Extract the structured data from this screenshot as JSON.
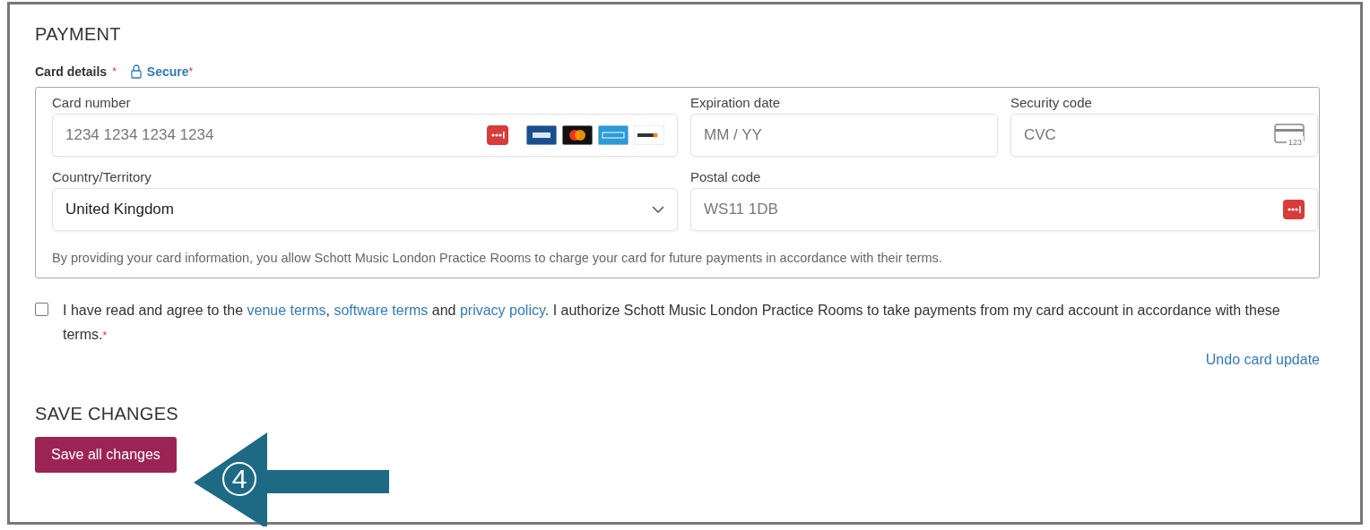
{
  "payment": {
    "title": "PAYMENT",
    "card_details_label": "Card details",
    "card_details_mark": "*",
    "secure_label": "Secure",
    "secure_mark": "*",
    "fields": [
      {
        "kind": "card",
        "label": "Card number",
        "placeholder": "1234 1234 1234 1234"
      },
      {
        "kind": "plain",
        "label": "Expiration date",
        "placeholder": "MM / YY"
      },
      {
        "kind": "cvc",
        "label": "Security code",
        "placeholder": "CVC",
        "icon_text": "123"
      },
      {
        "kind": "select",
        "label": "Country/Territory",
        "value": "United Kingdom"
      },
      {
        "kind": "autofill",
        "label": "Postal code",
        "placeholder": "WS11 1DB"
      }
    ],
    "notice": "By providing your card information, you allow Schott Music London Practice Rooms to charge your card for future payments in accordance with their terms."
  },
  "consent": {
    "checked": false,
    "required_mark": "*",
    "segments": [
      {
        "kind": "text",
        "text": "I have read and agree to the "
      },
      {
        "kind": "link",
        "text": "venue terms"
      },
      {
        "kind": "text",
        "text": ", "
      },
      {
        "kind": "link",
        "text": "software terms"
      },
      {
        "kind": "text",
        "text": " and "
      },
      {
        "kind": "link",
        "text": "privacy policy"
      },
      {
        "kind": "text",
        "text": ".  I authorize Schott Music London Practice Rooms to take payments from my card account in accordance with these terms."
      }
    ]
  },
  "undo_link": "Undo card update",
  "save": {
    "title": "SAVE CHANGES",
    "button": "Save all changes"
  },
  "callout": {
    "number": "4"
  }
}
